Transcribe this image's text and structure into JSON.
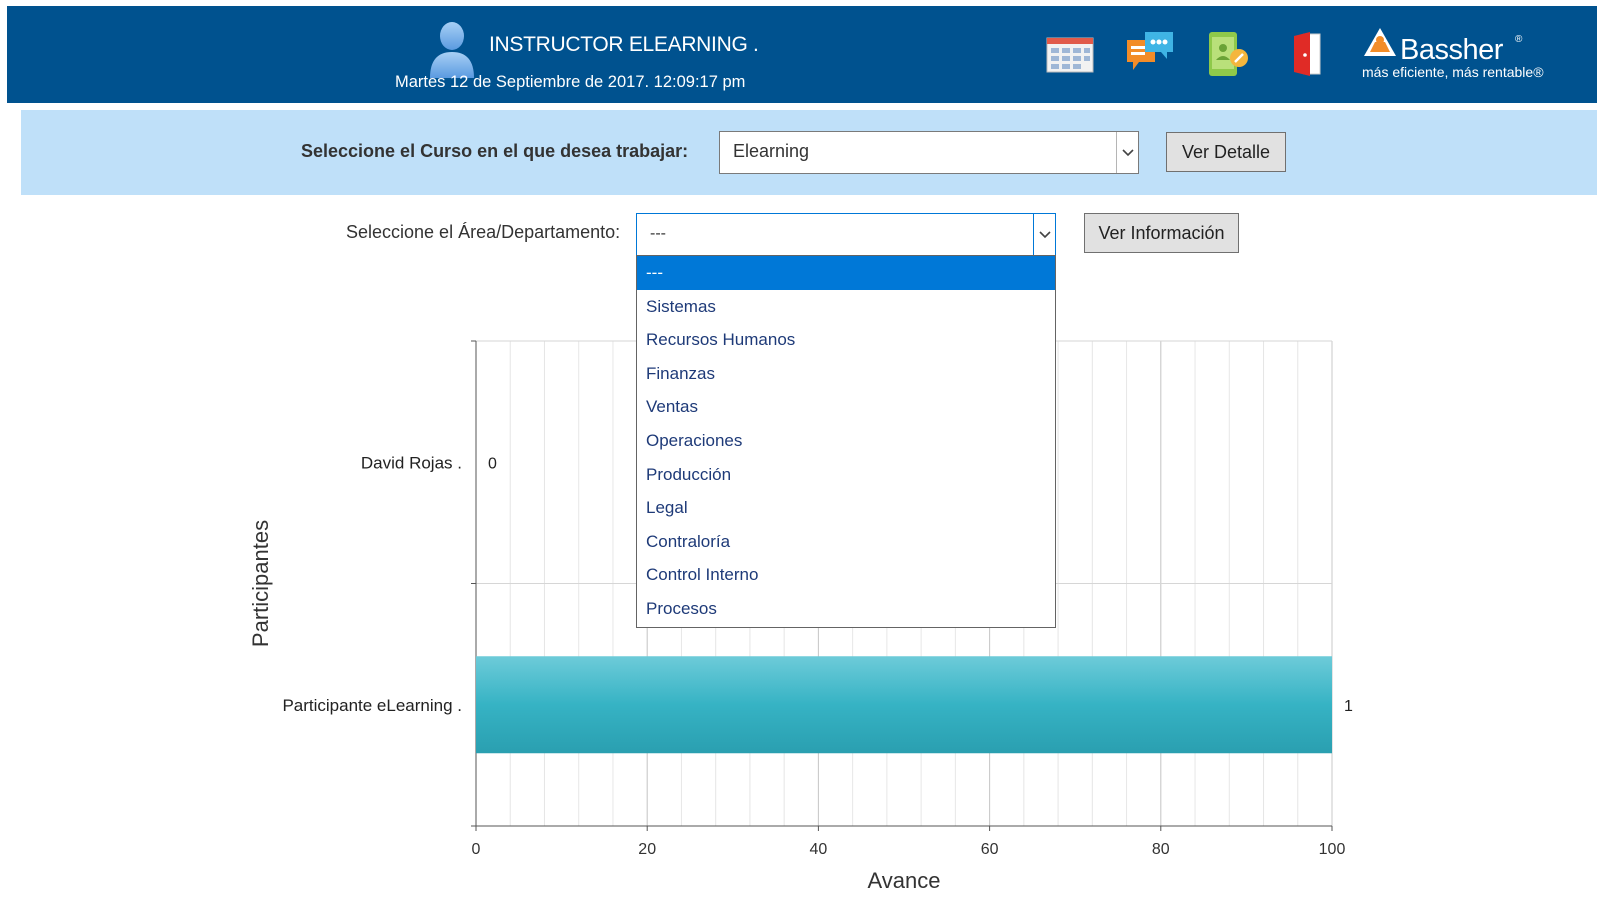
{
  "header": {
    "user_name": "INSTRUCTOR ELEARNING .",
    "date": "Martes 12 de Septiembre de 2017. 12:09:17 pm",
    "icons": [
      "calendar-grid-icon",
      "chat-bubbles-icon",
      "tablet-edit-icon",
      "exit-door-icon"
    ],
    "logo": {
      "name": "Bassher",
      "tagline": "más eficiente, más rentable®"
    },
    "colors": {
      "bar": "#00528f"
    }
  },
  "course": {
    "label": "Seleccione el Curso en el que desea trabajar:",
    "selected": "Elearning",
    "button": "Ver Detalle"
  },
  "area": {
    "label": "Seleccione el Área/Departamento:",
    "selected": "---",
    "button": "Ver Información",
    "options": [
      "---",
      "Sistemas",
      "Recursos Humanos",
      "Finanzas",
      "Ventas",
      "Operaciones",
      "Producción",
      "Legal",
      "Contraloría",
      "Control Interno",
      "Procesos"
    ]
  },
  "chart_data": {
    "type": "bar",
    "orientation": "horizontal",
    "categories": [
      "David Rojas .",
      "Participante eLearning ."
    ],
    "values": [
      0,
      100
    ],
    "data_labels": [
      "0",
      "1"
    ],
    "xlabel": "Avance",
    "ylabel": "Participantes",
    "xlim": [
      0,
      100
    ],
    "xticks": [
      0,
      20,
      40,
      60,
      80,
      100
    ],
    "grid": true,
    "bar_color": "#36b3c4"
  }
}
